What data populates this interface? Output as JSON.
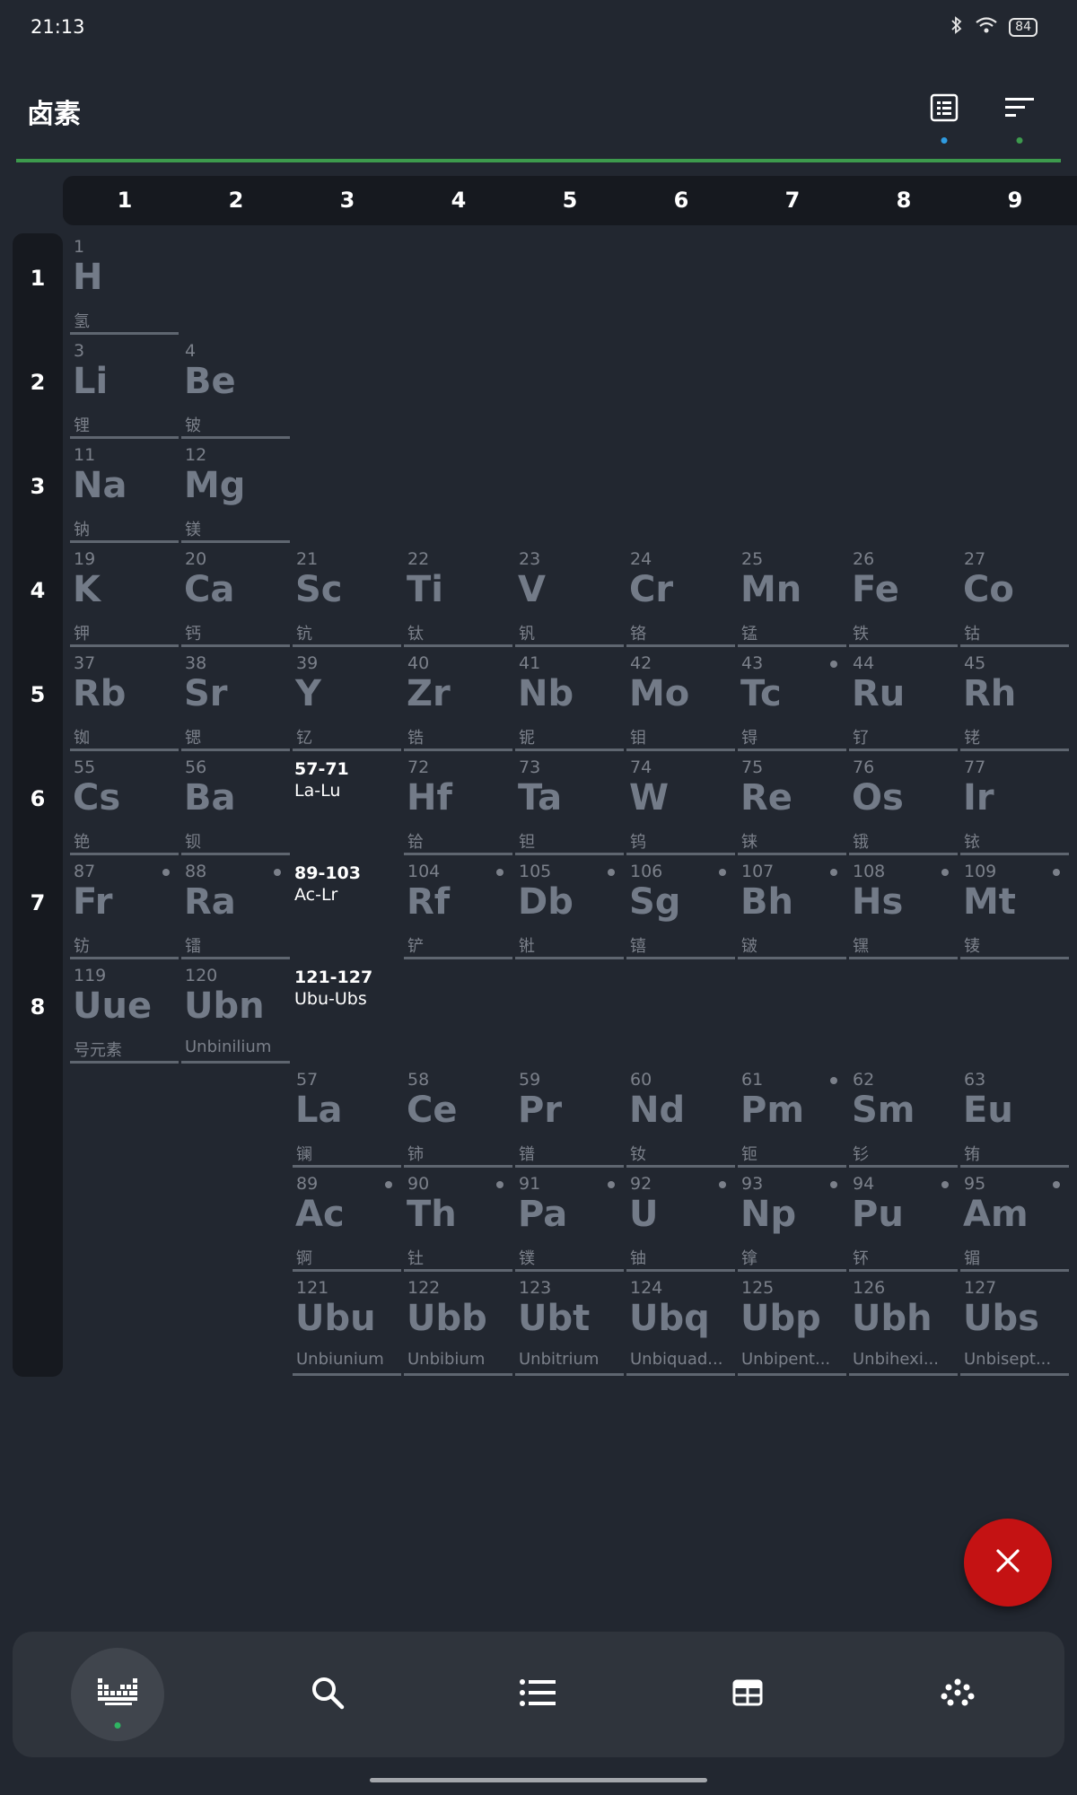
{
  "status_bar": {
    "time": "21:13",
    "battery": "84"
  },
  "header": {
    "title": "卤素"
  },
  "columns": [
    "1",
    "2",
    "3",
    "4",
    "5",
    "6",
    "7",
    "8",
    "9"
  ],
  "rows": [
    "1",
    "2",
    "3",
    "4",
    "5",
    "6",
    "7",
    "8"
  ],
  "elements": [
    {
      "n": "1",
      "s": "H",
      "name": "氢",
      "r": 1,
      "c": 1
    },
    {
      "n": "3",
      "s": "Li",
      "name": "锂",
      "r": 2,
      "c": 1
    },
    {
      "n": "4",
      "s": "Be",
      "name": "铍",
      "r": 2,
      "c": 2
    },
    {
      "n": "11",
      "s": "Na",
      "name": "钠",
      "r": 3,
      "c": 1
    },
    {
      "n": "12",
      "s": "Mg",
      "name": "镁",
      "r": 3,
      "c": 2
    },
    {
      "n": "19",
      "s": "K",
      "name": "钾",
      "r": 4,
      "c": 1
    },
    {
      "n": "20",
      "s": "Ca",
      "name": "钙",
      "r": 4,
      "c": 2
    },
    {
      "n": "21",
      "s": "Sc",
      "name": "钪",
      "r": 4,
      "c": 3
    },
    {
      "n": "22",
      "s": "Ti",
      "name": "钛",
      "r": 4,
      "c": 4
    },
    {
      "n": "23",
      "s": "V",
      "name": "钒",
      "r": 4,
      "c": 5
    },
    {
      "n": "24",
      "s": "Cr",
      "name": "铬",
      "r": 4,
      "c": 6
    },
    {
      "n": "25",
      "s": "Mn",
      "name": "锰",
      "r": 4,
      "c": 7
    },
    {
      "n": "26",
      "s": "Fe",
      "name": "铁",
      "r": 4,
      "c": 8
    },
    {
      "n": "27",
      "s": "Co",
      "name": "钴",
      "r": 4,
      "c": 9
    },
    {
      "n": "37",
      "s": "Rb",
      "name": "铷",
      "r": 5,
      "c": 1
    },
    {
      "n": "38",
      "s": "Sr",
      "name": "锶",
      "r": 5,
      "c": 2
    },
    {
      "n": "39",
      "s": "Y",
      "name": "钇",
      "r": 5,
      "c": 3
    },
    {
      "n": "40",
      "s": "Zr",
      "name": "锆",
      "r": 5,
      "c": 4
    },
    {
      "n": "41",
      "s": "Nb",
      "name": "铌",
      "r": 5,
      "c": 5
    },
    {
      "n": "42",
      "s": "Mo",
      "name": "钼",
      "r": 5,
      "c": 6
    },
    {
      "n": "43",
      "s": "Tc",
      "name": "锝",
      "r": 5,
      "c": 7,
      "dot": true
    },
    {
      "n": "44",
      "s": "Ru",
      "name": "钌",
      "r": 5,
      "c": 8
    },
    {
      "n": "45",
      "s": "Rh",
      "name": "铑",
      "r": 5,
      "c": 9
    },
    {
      "n": "55",
      "s": "Cs",
      "name": "铯",
      "r": 6,
      "c": 1
    },
    {
      "n": "56",
      "s": "Ba",
      "name": "钡",
      "r": 6,
      "c": 2
    },
    {
      "n": "72",
      "s": "Hf",
      "name": "铪",
      "r": 6,
      "c": 4
    },
    {
      "n": "73",
      "s": "Ta",
      "name": "钽",
      "r": 6,
      "c": 5
    },
    {
      "n": "74",
      "s": "W",
      "name": "钨",
      "r": 6,
      "c": 6
    },
    {
      "n": "75",
      "s": "Re",
      "name": "铼",
      "r": 6,
      "c": 7
    },
    {
      "n": "76",
      "s": "Os",
      "name": "锇",
      "r": 6,
      "c": 8
    },
    {
      "n": "77",
      "s": "Ir",
      "name": "铱",
      "r": 6,
      "c": 9
    },
    {
      "n": "87",
      "s": "Fr",
      "name": "钫",
      "r": 7,
      "c": 1,
      "dot": true
    },
    {
      "n": "88",
      "s": "Ra",
      "name": "镭",
      "r": 7,
      "c": 2,
      "dot": true
    },
    {
      "n": "104",
      "s": "Rf",
      "name": "铲",
      "r": 7,
      "c": 4,
      "dot": true
    },
    {
      "n": "105",
      "s": "Db",
      "name": "𬭊",
      "r": 7,
      "c": 5,
      "dot": true
    },
    {
      "n": "106",
      "s": "Sg",
      "name": "𬭳",
      "r": 7,
      "c": 6,
      "dot": true
    },
    {
      "n": "107",
      "s": "Bh",
      "name": "𬭛",
      "r": 7,
      "c": 7,
      "dot": true
    },
    {
      "n": "108",
      "s": "Hs",
      "name": "𬭶",
      "r": 7,
      "c": 8,
      "dot": true
    },
    {
      "n": "109",
      "s": "Mt",
      "name": "鿏",
      "r": 7,
      "c": 9,
      "dot": true
    },
    {
      "n": "119",
      "s": "Uue",
      "name": "号元素",
      "r": 8,
      "c": 1
    },
    {
      "n": "120",
      "s": "Ubn",
      "name": "Unbinilium",
      "r": 8,
      "c": 2
    },
    {
      "n": "57",
      "s": "La",
      "name": "镧",
      "r": 9,
      "c": 3
    },
    {
      "n": "58",
      "s": "Ce",
      "name": "铈",
      "r": 9,
      "c": 4
    },
    {
      "n": "59",
      "s": "Pr",
      "name": "镨",
      "r": 9,
      "c": 5
    },
    {
      "n": "60",
      "s": "Nd",
      "name": "钕",
      "r": 9,
      "c": 6
    },
    {
      "n": "61",
      "s": "Pm",
      "name": "钷",
      "r": 9,
      "c": 7,
      "dot": true
    },
    {
      "n": "62",
      "s": "Sm",
      "name": "钐",
      "r": 9,
      "c": 8
    },
    {
      "n": "63",
      "s": "Eu",
      "name": "铕",
      "r": 9,
      "c": 9
    },
    {
      "n": "89",
      "s": "Ac",
      "name": "锕",
      "r": 10,
      "c": 3,
      "dot": true
    },
    {
      "n": "90",
      "s": "Th",
      "name": "钍",
      "r": 10,
      "c": 4,
      "dot": true
    },
    {
      "n": "91",
      "s": "Pa",
      "name": "镤",
      "r": 10,
      "c": 5,
      "dot": true
    },
    {
      "n": "92",
      "s": "U",
      "name": "铀",
      "r": 10,
      "c": 6,
      "dot": true
    },
    {
      "n": "93",
      "s": "Np",
      "name": "镎",
      "r": 10,
      "c": 7,
      "dot": true
    },
    {
      "n": "94",
      "s": "Pu",
      "name": "钚",
      "r": 10,
      "c": 8,
      "dot": true
    },
    {
      "n": "95",
      "s": "Am",
      "name": "镅",
      "r": 10,
      "c": 9,
      "dot": true
    },
    {
      "n": "121",
      "s": "Ubu",
      "name": "Unbiunium",
      "r": 11,
      "c": 3
    },
    {
      "n": "122",
      "s": "Ubb",
      "name": "Unbibium",
      "r": 11,
      "c": 4
    },
    {
      "n": "123",
      "s": "Ubt",
      "name": "Unbitrium",
      "r": 11,
      "c": 5
    },
    {
      "n": "124",
      "s": "Ubq",
      "name": "Unbiquad...",
      "r": 11,
      "c": 6
    },
    {
      "n": "125",
      "s": "Ubp",
      "name": "Unbipent...",
      "r": 11,
      "c": 7
    },
    {
      "n": "126",
      "s": "Ubh",
      "name": "Unbihexi...",
      "r": 11,
      "c": 8
    },
    {
      "n": "127",
      "s": "Ubs",
      "name": "Unbisept...",
      "r": 11,
      "c": 9
    }
  ],
  "ranges": [
    {
      "num": "57-71",
      "sym": "La-Lu",
      "r": 6,
      "c": 3
    },
    {
      "num": "89-103",
      "sym": "Ac-Lr",
      "r": 7,
      "c": 3
    },
    {
      "num": "121-127",
      "sym": "Ubu-Ubs",
      "r": 8,
      "c": 3
    }
  ],
  "colors": {
    "accent_green": "#3d9a4d",
    "fab_red": "#c41213",
    "dot_blue": "#2f9be0"
  },
  "icons": {
    "toolbar": [
      "table-layout-icon",
      "sort-icon"
    ],
    "fab": "close-icon",
    "nav": [
      "periodic-table-icon",
      "search-icon",
      "list-icon",
      "table-icon",
      "dots-grid-icon"
    ]
  }
}
